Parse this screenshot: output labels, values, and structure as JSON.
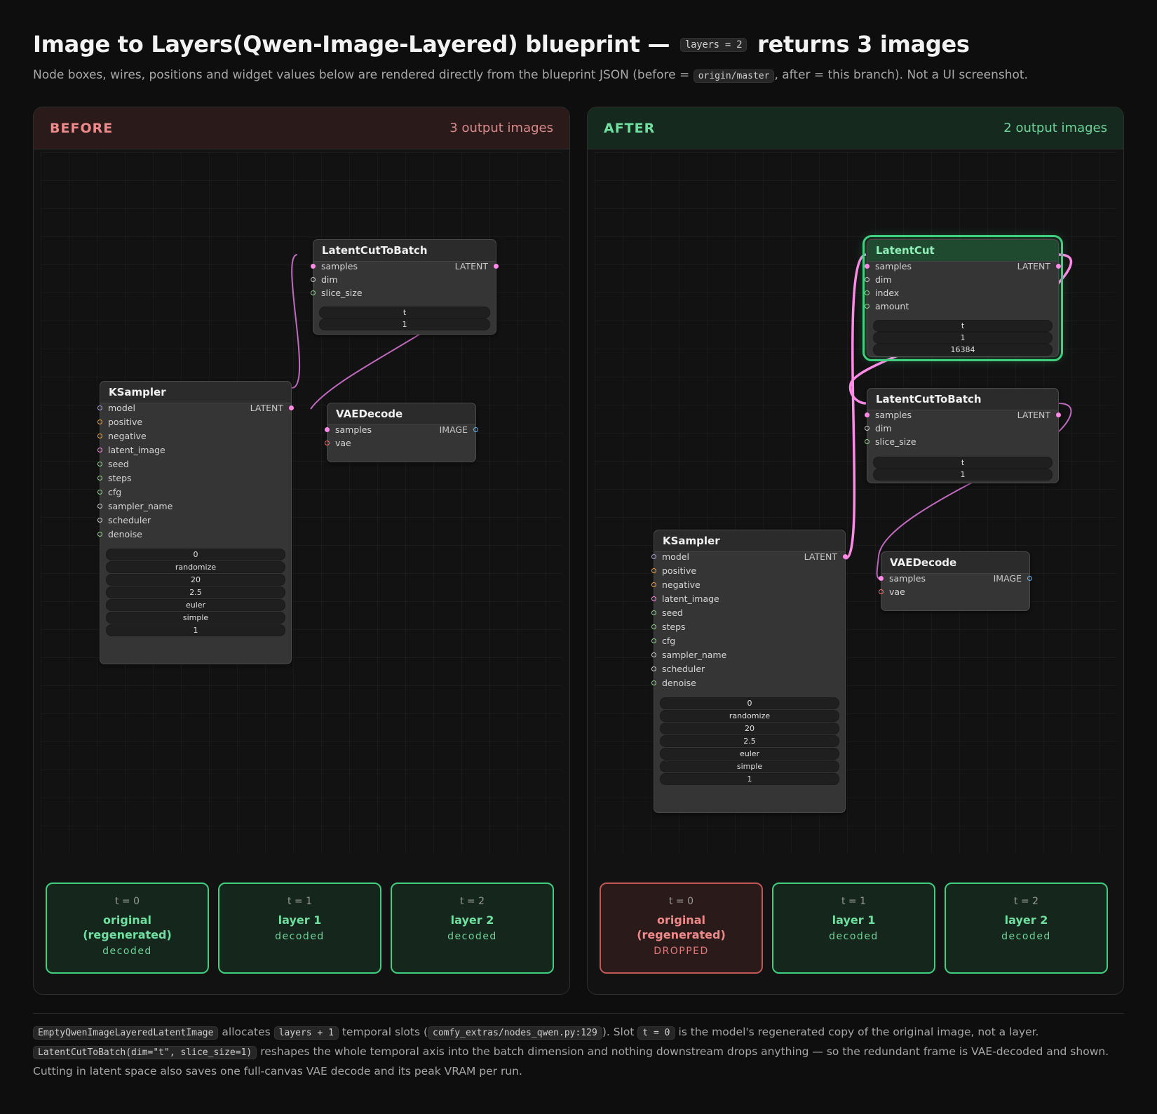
{
  "title": {
    "prefix": "Image to Layers(Qwen-Image-Layered) blueprint —",
    "code": "layers = 2",
    "suffix": "returns 3 images"
  },
  "subtitle": {
    "part1": "Node boxes, wires, positions and widget values below are rendered directly from the blueprint JSON (before =",
    "code": "origin/master",
    "part2": ", after = this branch). Not a UI screenshot."
  },
  "colors": {
    "latent": "#ff8ae8",
    "model": "#b39ddb",
    "conditioning": "#f0a040",
    "number": "#8fd68f",
    "combo": "#cccccc",
    "image": "#64b5f6",
    "vae": "#ff6e6e",
    "accent_green": "#3fcf7e",
    "accent_red": "#c25757"
  },
  "before": {
    "label": "BEFORE",
    "count": "3 output images",
    "nodes": {
      "cut_to_batch": {
        "title": "LatentCutToBatch",
        "inputs": [
          "samples",
          "dim",
          "slice_size"
        ],
        "output": "LATENT",
        "widgets": [
          "t",
          "1"
        ]
      },
      "ksampler": {
        "title": "KSampler",
        "inputs": [
          "model",
          "positive",
          "negative",
          "latent_image",
          "seed",
          "steps",
          "cfg",
          "sampler_name",
          "scheduler",
          "denoise"
        ],
        "output": "LATENT",
        "widgets": [
          "0",
          "randomize",
          "20",
          "2.5",
          "euler",
          "simple",
          "1"
        ]
      },
      "vae_decode": {
        "title": "VAEDecode",
        "inputs": [
          "samples",
          "vae"
        ],
        "output": "IMAGE"
      }
    },
    "outputs": [
      {
        "t": "t = 0",
        "name": "original (regenerated)",
        "status": "decoded"
      },
      {
        "t": "t = 1",
        "name": "layer 1",
        "status": "decoded"
      },
      {
        "t": "t = 2",
        "name": "layer 2",
        "status": "decoded"
      }
    ]
  },
  "after": {
    "label": "AFTER",
    "count": "2 output images",
    "nodes": {
      "latent_cut": {
        "title": "LatentCut",
        "inputs": [
          "samples",
          "dim",
          "index",
          "amount"
        ],
        "output": "LATENT",
        "widgets": [
          "t",
          "1",
          "16384"
        ]
      },
      "cut_to_batch": {
        "title": "LatentCutToBatch",
        "inputs": [
          "samples",
          "dim",
          "slice_size"
        ],
        "output": "LATENT",
        "widgets": [
          "t",
          "1"
        ]
      },
      "ksampler": {
        "title": "KSampler",
        "inputs": [
          "model",
          "positive",
          "negative",
          "latent_image",
          "seed",
          "steps",
          "cfg",
          "sampler_name",
          "scheduler",
          "denoise"
        ],
        "output": "LATENT",
        "widgets": [
          "0",
          "randomize",
          "20",
          "2.5",
          "euler",
          "simple",
          "1"
        ]
      },
      "vae_decode": {
        "title": "VAEDecode",
        "inputs": [
          "samples",
          "vae"
        ],
        "output": "IMAGE"
      }
    },
    "outputs": [
      {
        "t": "t = 0",
        "name": "original (regenerated)",
        "status": "DROPPED"
      },
      {
        "t": "t = 1",
        "name": "layer 1",
        "status": "decoded"
      },
      {
        "t": "t = 2",
        "name": "layer 2",
        "status": "decoded"
      }
    ]
  },
  "footnote": {
    "c1": "EmptyQwenImageLayeredLatentImage",
    "t1": "allocates",
    "c2": "layers + 1",
    "t2": "temporal slots (",
    "c3": "comfy_extras/nodes_qwen.py:129",
    "t3": "). Slot",
    "c4": "t = 0",
    "t4": "is the model's regenerated copy of the original image, not a layer.",
    "c5": "LatentCutToBatch(dim=\"t\", slice_size=1)",
    "t5": "reshapes the whole temporal axis into the batch dimension and nothing downstream drops anything — so the redundant frame is VAE-decoded and shown. Cutting in latent space also saves one full-canvas VAE decode and its peak VRAM per run."
  }
}
